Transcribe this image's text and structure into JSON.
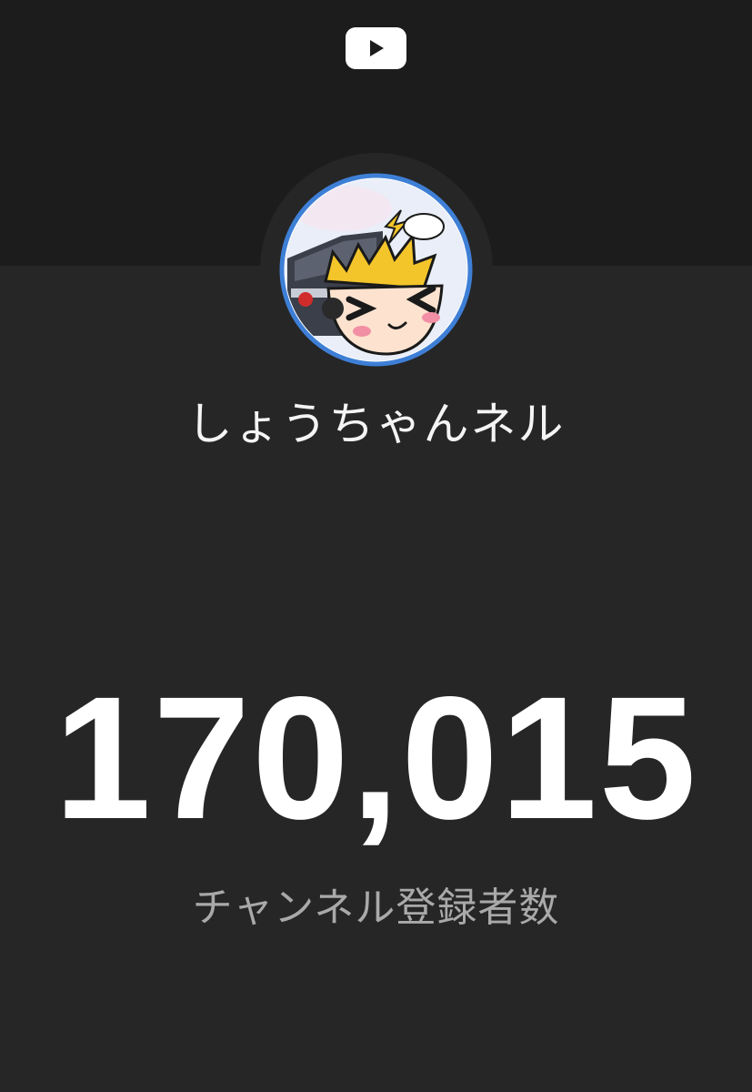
{
  "brand": {
    "logo_icon": "youtube-play-icon",
    "logo_color": "#ffffff"
  },
  "channel": {
    "name": "しょうちゃんネル",
    "avatar_icon": "cartoon-avatar",
    "avatar_ring_color": "#4a90e2"
  },
  "subscribers": {
    "count": "170,015",
    "label": "チャンネル登録者数"
  },
  "colors": {
    "background": "#262626",
    "header_band": "#1c1c1c",
    "count_text": "#ffffff",
    "label_text": "#a9a9a9"
  }
}
